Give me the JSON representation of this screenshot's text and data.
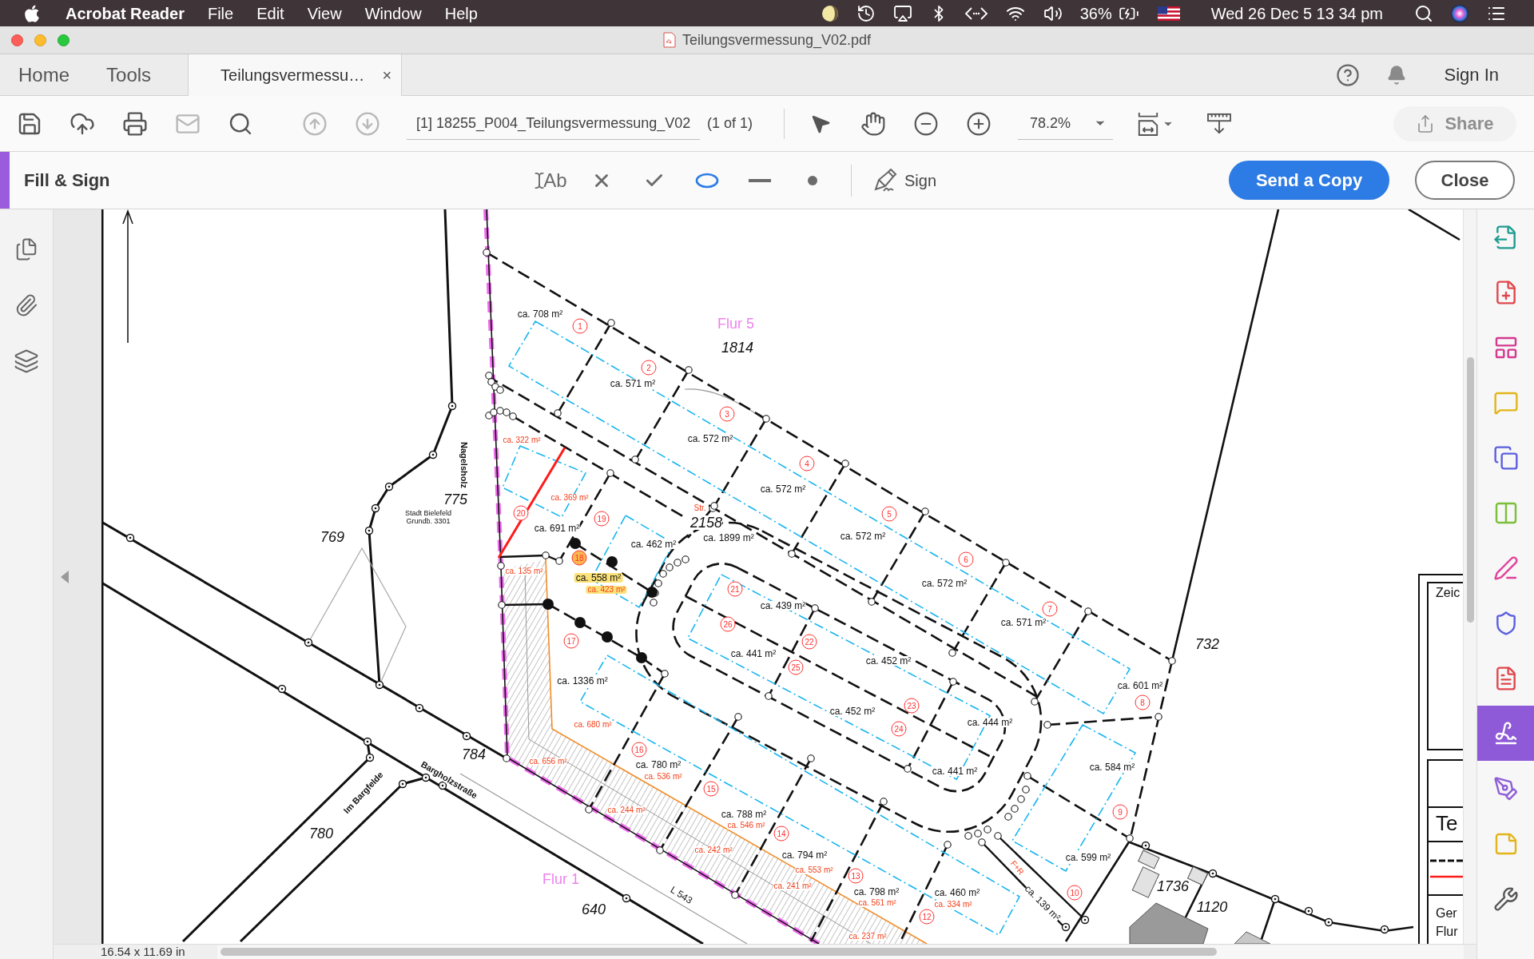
{
  "menu_bar": {
    "app_name": "Acrobat Reader",
    "menus": [
      "File",
      "Edit",
      "View",
      "Window",
      "Help"
    ],
    "battery": "36%",
    "clock": "Wed 26 Dec 5 13 34 pm"
  },
  "window": {
    "title": "Teilungsvermessung_V02.pdf"
  },
  "tabs": [
    {
      "kind": "nav",
      "label": "Home",
      "selected": false
    },
    {
      "kind": "nav",
      "label": "Tools",
      "selected": false
    },
    {
      "kind": "document",
      "label": "Teilungsvermessu…",
      "close": "×",
      "selected": true
    }
  ],
  "account": {
    "sign_in": "Sign In"
  },
  "toolbar": {
    "buttons": [
      {
        "kind": "save",
        "disabled": false
      },
      {
        "kind": "upload",
        "disabled": false
      },
      {
        "kind": "print",
        "disabled": false
      },
      {
        "kind": "mail",
        "disabled": true
      },
      {
        "kind": "search",
        "disabled": false
      },
      {
        "kind": "previous",
        "disabled": true
      },
      {
        "kind": "next",
        "disabled": true
      }
    ],
    "page_field": "[1] 18255_P004_Teilungsvermessung_V02",
    "page_count": "(1 of 1)",
    "zoom": "78.2%",
    "share": {
      "label": "Share",
      "disabled": true
    }
  },
  "fill_sign": {
    "title": "Fill & Sign",
    "tools": [
      {
        "kind": "text",
        "label": "Ab",
        "selected": false
      },
      {
        "kind": "cross",
        "selected": false
      },
      {
        "kind": "check",
        "selected": false
      },
      {
        "kind": "circle",
        "selected": true
      },
      {
        "kind": "line",
        "selected": false
      },
      {
        "kind": "dot",
        "selected": false
      }
    ],
    "sign": "Sign",
    "send": "Send a Copy",
    "close": "Close"
  },
  "right_panel": {
    "tools": [
      {
        "kind": "export",
        "selected": false
      },
      {
        "kind": "create",
        "selected": false
      },
      {
        "kind": "edit",
        "selected": false
      },
      {
        "kind": "comment",
        "selected": false
      },
      {
        "kind": "combine",
        "selected": false
      },
      {
        "kind": "organize",
        "selected": false
      },
      {
        "kind": "fill",
        "selected": false
      },
      {
        "kind": "protect",
        "selected": false
      },
      {
        "kind": "pdf",
        "selected": false
      },
      {
        "kind": "sign",
        "selected": true
      },
      {
        "kind": "signature",
        "selected": false
      },
      {
        "kind": "review",
        "selected": false
      },
      {
        "kind": "more",
        "selected": false
      }
    ]
  },
  "document": {
    "page_size": "16.54 x 11.69 in",
    "labels": [
      {
        "kind": "flur",
        "text": "Flur 5",
        "highlighted": false
      },
      {
        "kind": "parcel",
        "text": "1814",
        "highlighted": false
      },
      {
        "kind": "area",
        "text": "ca. 708 m²",
        "highlighted": false
      },
      {
        "kind": "plot",
        "text": "1",
        "highlighted": false
      },
      {
        "kind": "plot",
        "text": "2",
        "highlighted": false
      },
      {
        "kind": "area",
        "text": "ca. 571 m²",
        "highlighted": false
      },
      {
        "kind": "plot",
        "text": "3",
        "highlighted": false
      },
      {
        "kind": "area",
        "text": "ca. 572 m²",
        "highlighted": false
      },
      {
        "kind": "plot",
        "text": "4",
        "highlighted": false
      },
      {
        "kind": "area",
        "text": "ca. 572 m²",
        "highlighted": false
      },
      {
        "kind": "plot",
        "text": "5",
        "highlighted": false
      },
      {
        "kind": "area",
        "text": "ca. 572 m²",
        "highlighted": false
      },
      {
        "kind": "plot",
        "text": "6",
        "highlighted": false
      },
      {
        "kind": "area",
        "text": "ca. 572 m²",
        "highlighted": false
      },
      {
        "kind": "plot",
        "text": "7",
        "highlighted": false
      },
      {
        "kind": "area",
        "text": "ca. 571 m²",
        "highlighted": false
      },
      {
        "kind": "parcel",
        "text": "732",
        "highlighted": false
      },
      {
        "kind": "area",
        "text": "ca. 601 m²",
        "highlighted": false
      },
      {
        "kind": "plot",
        "text": "8",
        "highlighted": false
      },
      {
        "kind": "street",
        "text": "Nagelsholz",
        "highlighted": false
      },
      {
        "kind": "parcel",
        "text": "775",
        "highlighted": false
      },
      {
        "kind": "note",
        "text": "Stadt Bielefeld",
        "highlighted": false
      },
      {
        "kind": "note",
        "text": "Grundb. 3301",
        "highlighted": false
      },
      {
        "kind": "sub_area",
        "text": "ca. 322 m²",
        "highlighted": false
      },
      {
        "kind": "sub_area",
        "text": "ca. 369 m²",
        "highlighted": false
      },
      {
        "kind": "plot",
        "text": "20",
        "highlighted": false
      },
      {
        "kind": "parcel",
        "text": "769",
        "highlighted": false
      },
      {
        "kind": "area",
        "text": "ca. 691 m²",
        "highlighted": false
      },
      {
        "kind": "plot",
        "text": "19",
        "highlighted": false
      },
      {
        "kind": "area",
        "text": "ca. 462 m²",
        "highlighted": false
      },
      {
        "kind": "sub_area",
        "text": "Str.",
        "highlighted": false
      },
      {
        "kind": "parcel",
        "text": "2158",
        "highlighted": false
      },
      {
        "kind": "area",
        "text": "ca. 1899 m²",
        "highlighted": false
      },
      {
        "kind": "plot",
        "text": "18",
        "highlighted": true
      },
      {
        "kind": "sub_area",
        "text": "ca. 135 m²",
        "highlighted": false
      },
      {
        "kind": "area",
        "text": "ca. 558 m²",
        "highlighted": true
      },
      {
        "kind": "sub_area",
        "text": "ca. 423 m²",
        "highlighted": true
      },
      {
        "kind": "plot",
        "text": "21",
        "highlighted": false
      },
      {
        "kind": "area",
        "text": "ca. 439 m²",
        "highlighted": false
      },
      {
        "kind": "plot",
        "text": "26",
        "highlighted": false
      },
      {
        "kind": "plot",
        "text": "17",
        "highlighted": false
      },
      {
        "kind": "plot",
        "text": "22",
        "highlighted": false
      },
      {
        "kind": "area",
        "text": "ca. 441 m²",
        "highlighted": false
      },
      {
        "kind": "area",
        "text": "ca. 452 m²",
        "highlighted": false
      },
      {
        "kind": "plot",
        "text": "25",
        "highlighted": false
      },
      {
        "kind": "area",
        "text": "ca. 1336 m²",
        "highlighted": false
      },
      {
        "kind": "area",
        "text": "ca. 452 m²",
        "highlighted": false
      },
      {
        "kind": "plot",
        "text": "23",
        "highlighted": false
      },
      {
        "kind": "area",
        "text": "ca. 444 m²",
        "highlighted": false
      },
      {
        "kind": "sub_area",
        "text": "ca. 680 m²",
        "highlighted": false
      },
      {
        "kind": "plot",
        "text": "24",
        "highlighted": false
      },
      {
        "kind": "area",
        "text": "ca. 584 m²",
        "highlighted": false
      },
      {
        "kind": "plot",
        "text": "16",
        "highlighted": false
      },
      {
        "kind": "parcel",
        "text": "784",
        "highlighted": false
      },
      {
        "kind": "sub_area",
        "text": "ca. 656 m²",
        "highlighted": false
      },
      {
        "kind": "area",
        "text": "ca. 780 m²",
        "highlighted": false
      },
      {
        "kind": "sub_area",
        "text": "ca. 536 m²",
        "highlighted": false
      },
      {
        "kind": "area",
        "text": "ca. 441 m²",
        "highlighted": false
      },
      {
        "kind": "street",
        "text": "Bargholzstraße",
        "highlighted": false
      },
      {
        "kind": "street",
        "text": "Im Bargfelde",
        "highlighted": false
      },
      {
        "kind": "plot",
        "text": "15",
        "highlighted": false
      },
      {
        "kind": "sub_area",
        "text": "ca. 244 m²",
        "highlighted": false
      },
      {
        "kind": "area",
        "text": "ca. 788 m²",
        "highlighted": false
      },
      {
        "kind": "plot",
        "text": "9",
        "highlighted": false
      },
      {
        "kind": "sub_area",
        "text": "ca. 546 m²",
        "highlighted": false
      },
      {
        "kind": "parcel",
        "text": "780",
        "highlighted": false
      },
      {
        "kind": "plot",
        "text": "14",
        "highlighted": false
      },
      {
        "kind": "sub_area",
        "text": "ca. 242 m²",
        "highlighted": false
      },
      {
        "kind": "area",
        "text": "ca. 794 m²",
        "highlighted": false
      },
      {
        "kind": "area",
        "text": "ca. 599 m²",
        "highlighted": false
      },
      {
        "kind": "sub_area",
        "text": "F+R",
        "highlighted": false
      },
      {
        "kind": "sub_area",
        "text": "ca. 553 m²",
        "highlighted": false
      },
      {
        "kind": "plot",
        "text": "13",
        "highlighted": false
      },
      {
        "kind": "flur",
        "text": "Flur 1",
        "highlighted": false
      },
      {
        "kind": "sub_area",
        "text": "ca. 241 m²",
        "highlighted": false
      },
      {
        "kind": "area",
        "text": "ca. 798 m²",
        "highlighted": false
      },
      {
        "kind": "area",
        "text": "ca. 460 m²",
        "highlighted": false
      },
      {
        "kind": "plot",
        "text": "10",
        "highlighted": false
      },
      {
        "kind": "parcel",
        "text": "1736",
        "highlighted": false
      },
      {
        "kind": "parcel",
        "text": "640",
        "highlighted": false
      },
      {
        "kind": "road",
        "text": "L 543",
        "highlighted": false
      },
      {
        "kind": "sub_area",
        "text": "ca. 561 m²",
        "highlighted": false
      },
      {
        "kind": "plot",
        "text": "12",
        "highlighted": false
      },
      {
        "kind": "sub_area",
        "text": "ca. 334 m²",
        "highlighted": false
      },
      {
        "kind": "area",
        "text": "ca. 139 m²",
        "highlighted": false
      },
      {
        "kind": "parcel",
        "text": "1120",
        "highlighted": false
      },
      {
        "kind": "sub_area",
        "text": "ca. 237 m²",
        "highlighted": false
      },
      {
        "kind": "legend",
        "text": "Zeic",
        "highlighted": false
      },
      {
        "kind": "legend_title",
        "text": "Te",
        "highlighted": false
      },
      {
        "kind": "legend",
        "text": "Ger",
        "highlighted": false
      },
      {
        "kind": "legend",
        "text": "Flur",
        "highlighted": false
      }
    ]
  }
}
